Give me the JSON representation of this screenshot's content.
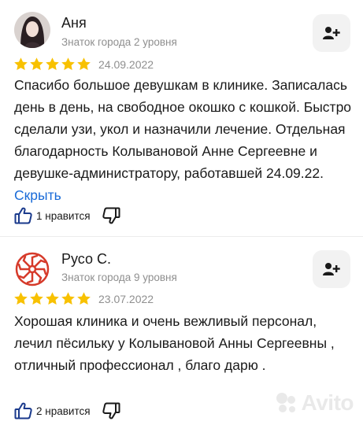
{
  "reviews": [
    {
      "author": "Аня",
      "level": "Знаток города 2 уровня",
      "rating": 5,
      "date": "24.09.2022",
      "text": "Спасибо большое девушкам в клинике. Записалась день в день, на свободное окошко с кошкой. Быстро сделали узи, укол и назначили лечение. Отдельная благодарность Колывановой Анне Сергеевне и девушке-администратору, работавшей 24.09.22. ",
      "more_label": "Скрыть",
      "likes_label": "1 нравится",
      "avatar_icon": "user-photo"
    },
    {
      "author": "Русо С.",
      "level": "Знаток города 9 уровня",
      "rating": 5,
      "date": "23.07.2022",
      "text": "Хорошая клиника и очень вежливый персонал, лечил пёсильку у Колывановой Анны Сергеевны , отличный профессионал , благо дарю .",
      "likes_label": "2 нравится",
      "avatar_icon": "red-symbol-icon"
    }
  ],
  "colors": {
    "star": "#f8c100",
    "link": "#1a6bd8",
    "muted": "#8f8f8f",
    "button_bg": "#f2f2f2",
    "accent_red": "#d63a2a"
  },
  "watermark": {
    "text": "Avito"
  }
}
